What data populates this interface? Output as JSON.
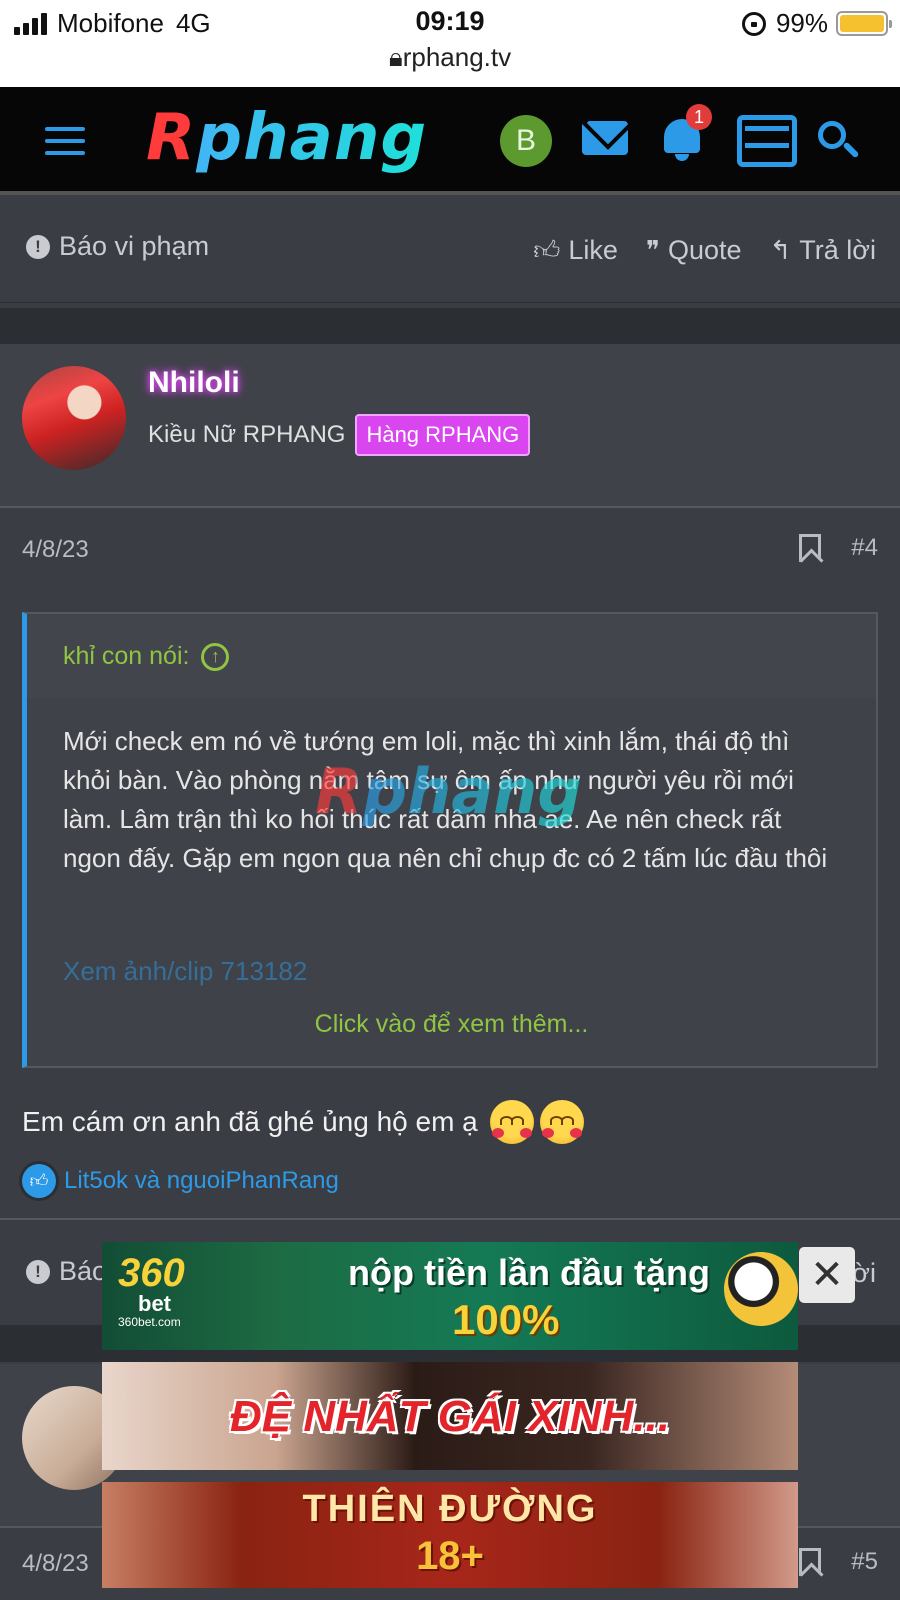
{
  "status_bar": {
    "carrier": "Mobifone",
    "network": "4G",
    "time": "09:19",
    "url": "rphang.tv",
    "battery": "99%"
  },
  "header": {
    "logo_text": "Rphang",
    "avatar_letter": "B",
    "notification_count": "1",
    "icons": [
      "menu-icon",
      "envelope-icon",
      "bell-icon",
      "store-icon",
      "search-icon"
    ],
    "accent_color": "#2d9ae8"
  },
  "action_bar": {
    "report": "Báo vi phạm",
    "like": "Like",
    "quote": "Quote",
    "reply": "Trả lời"
  },
  "post": {
    "username": "Nhiloli",
    "user_title": "Kiều Nữ RPHANG",
    "user_badge": "Hàng RPHANG",
    "date": "4/8/23",
    "number": "#4",
    "quote": {
      "author": "khỉ con nói:",
      "text": "Mới check em nó về tướng em loli, mặc thì xinh lắm, thái độ thì khỏi bàn. Vào phòng nằm tâm sự ôm ấp như người yêu rồi mới làm. Lâm trận thì ko hối thúc rất dâm nha ae. Ae nên check rất ngon đấy. Gặp em ngon qua nên chỉ chụp đc có 2 tấm lúc đầu thôi",
      "link": "Xem ảnh/clip 713182",
      "expand": "Click vào để xem thêm..."
    },
    "reply_text": "Em cám ơn anh đã ghé ủng hộ em ạ",
    "likes": "Lit5ok và nguoiPhanRang"
  },
  "second_action_bar": {
    "report": "Báo",
    "reply": "Trả lời"
  },
  "next_post": {
    "date": "4/8/23",
    "number": "#5"
  },
  "ads": {
    "ad1_logo_top": "360",
    "ad1_logo_bet": "bet",
    "ad1_logo_domain": "360bet.com",
    "ad1_line1": "nộp tiền lần đầu tặng",
    "ad1_line2": "100%",
    "ad2_text": "ĐỆ NHẤT GÁI XINH...",
    "ad3_line1": "THIÊN ĐƯỜNG",
    "ad3_line2": "18+",
    "close_symbol": "✕"
  },
  "watermark": "Rphang"
}
